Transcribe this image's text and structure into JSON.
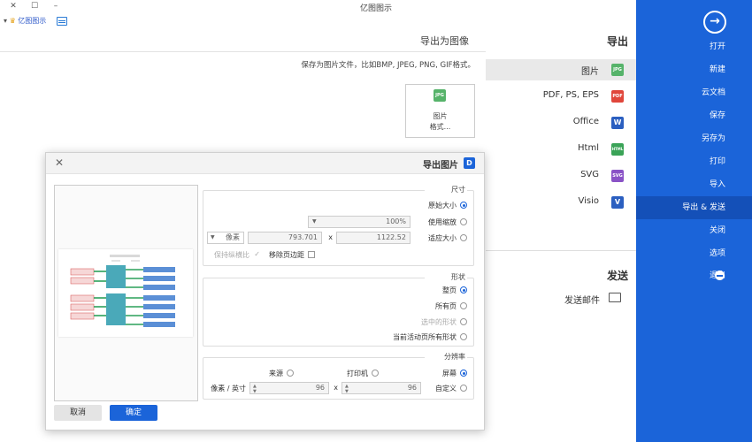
{
  "window": {
    "title": "亿图图示"
  },
  "qat": {
    "brand": "亿图图示"
  },
  "sidebar": {
    "back_icon": "arrow-right-circle-icon",
    "items": [
      {
        "label": "打开"
      },
      {
        "label": "新建"
      },
      {
        "label": "云文档"
      },
      {
        "label": "保存"
      },
      {
        "label": "另存为"
      },
      {
        "label": "打印"
      },
      {
        "label": "导入"
      },
      {
        "label": "导出 & 发送"
      },
      {
        "label": "关闭"
      },
      {
        "label": "选项"
      },
      {
        "label": "退出"
      }
    ],
    "accent": "#1b64d9"
  },
  "export_panel": {
    "heading": "导出",
    "formats": [
      {
        "label": "图片",
        "icon": "JPG",
        "color": "#56b36a"
      },
      {
        "label": "PDF, PS, EPS",
        "icon": "PDF",
        "color": "#e0463b"
      },
      {
        "label": "Office",
        "icon": "W",
        "color": "#2b5fc0"
      },
      {
        "label": "Html",
        "icon": "HTML",
        "color": "#3aa357"
      },
      {
        "label": "SVG",
        "icon": "SVG",
        "color": "#8a53c6"
      },
      {
        "label": "Visio",
        "icon": "V",
        "color": "#2b5fc0"
      }
    ],
    "send_heading": "发送",
    "send_email": "发送邮件"
  },
  "content": {
    "title": "导出为图像",
    "description": "保存为图片文件，比如BMP, JPEG, PNG, GIF格式。",
    "card_label": "图片\n格式..."
  },
  "dialog": {
    "title": "导出图片",
    "size_group": {
      "title": "尺寸",
      "opt_original": "原始大小",
      "opt_zoom": "使用缩放",
      "zoom_value": "100%",
      "opt_fit": "适应大小",
      "width": "1122.52",
      "height": "793.701",
      "unit": "像素",
      "remove_margin": "移除页边距",
      "keep_ratio": "保持纵横比"
    },
    "shape_group": {
      "title": "形状",
      "opt_whole": "整页",
      "opt_all_pages": "所有页",
      "opt_selected": "选中的形状",
      "opt_current_all": "当前活动页所有形状"
    },
    "resolution_group": {
      "title": "分辨率",
      "opt_screen": "屏幕",
      "opt_printer": "打印机",
      "opt_source": "来源",
      "opt_custom": "自定义",
      "dpi_x": "96",
      "dpi_y": "96",
      "unit": "像素 / 英寸"
    },
    "ok": "确定",
    "cancel": "取消"
  }
}
